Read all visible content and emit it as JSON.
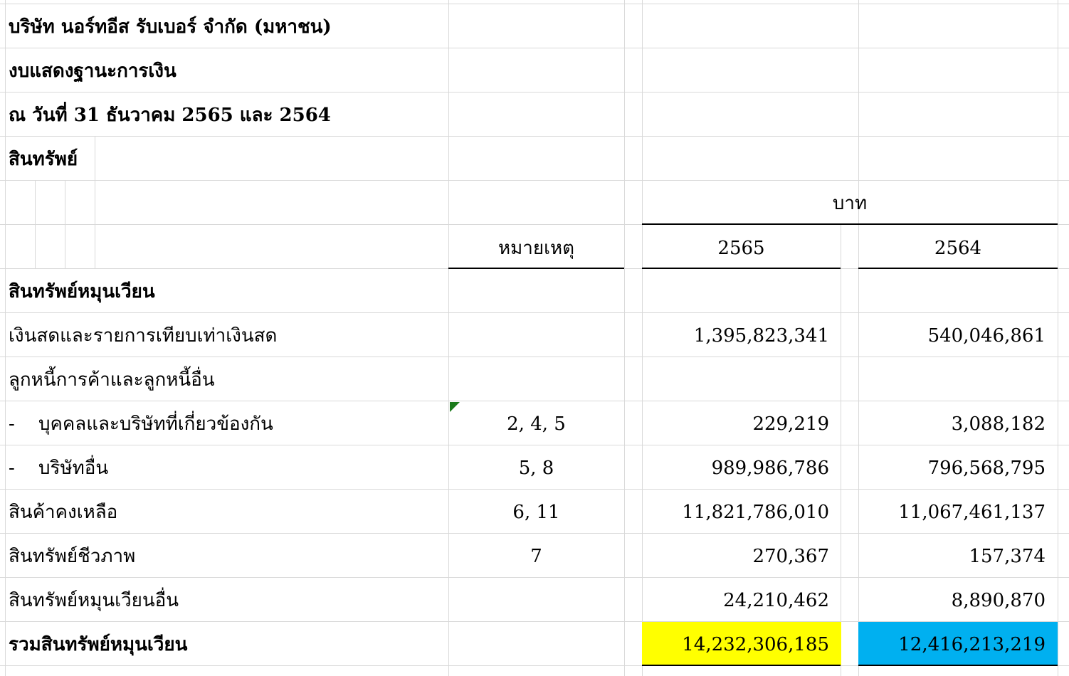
{
  "header": {
    "company": "บริษัท นอร์ทอีส รับเบอร์ จำกัด (มหาชน)",
    "statement": "งบแสดงฐานะการเงิน",
    "date": "ณ วันที่ 31 ธันวาคม 2565 และ 2564",
    "section": "สินทรัพย์"
  },
  "columns": {
    "currency": "บาท",
    "note": "หมายเหตุ",
    "year1": "2565",
    "year2": "2564"
  },
  "subsection": "สินทรัพย์หมุนเวียน",
  "rows": [
    {
      "label": "เงินสดและรายการเทียบเท่าเงินสด",
      "note": "",
      "v1": "1,395,823,341",
      "v2": "540,046,861"
    },
    {
      "label": "ลูกหนี้การค้าและลูกหนี้อื่น",
      "note": "",
      "v1": "",
      "v2": ""
    },
    {
      "dash": "-",
      "label": "บุคคลและบริษัทที่เกี่ยวข้องกัน",
      "note": "2, 4, 5",
      "v1": "229,219",
      "v2": "3,088,182"
    },
    {
      "dash": "-",
      "label": "บริษัทอื่น",
      "note": "5, 8",
      "v1": "989,986,786",
      "v2": "796,568,795"
    },
    {
      "label": "สินค้าคงเหลือ",
      "note": "6, 11",
      "v1": "11,821,786,010",
      "v2": "11,067,461,137"
    },
    {
      "label": "สินทรัพย์ชีวภาพ",
      "note": "7",
      "v1": "270,367",
      "v2": "157,374"
    },
    {
      "label": "สินทรัพย์หมุนเวียนอื่น",
      "note": "",
      "v1": "24,210,462",
      "v2": "8,890,870"
    }
  ],
  "total": {
    "label": "รวมสินทรัพย์หมุนเวียน",
    "v1": "14,232,306,185",
    "v2": "12,416,213,219"
  },
  "colors": {
    "grid": "#d9d9d9",
    "highlight_2565": "#ffff00",
    "highlight_2564": "#00b0f0",
    "comment_marker": "#1a7a1a"
  }
}
